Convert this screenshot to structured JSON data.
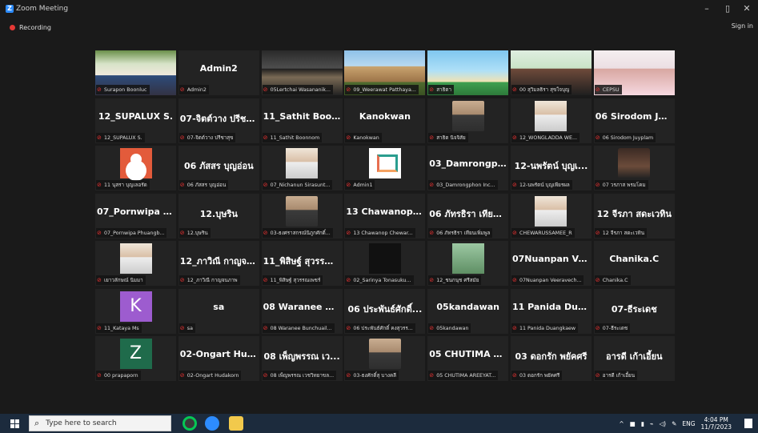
{
  "window": {
    "title": "Zoom Meeting",
    "minimize": "–",
    "restore": "▯",
    "close": "✕"
  },
  "recording": {
    "label": "Recording"
  },
  "signin": "Sign in",
  "tiles": [
    {
      "name": "",
      "label": "Surapon Boonluc",
      "video": "room",
      "active": true
    },
    {
      "name": "Admin2",
      "label": "Admin2"
    },
    {
      "name": "",
      "label": "05Lertchai Wasananik...",
      "video": "building"
    },
    {
      "name": "",
      "label": "09_Weerawat Patthaya...",
      "video": "palace"
    },
    {
      "name": "",
      "label": "สาธิตา",
      "video": "beach"
    },
    {
      "name": "",
      "label": "00 สุวิมลธิรา สุขใจบุญ",
      "video": "woman"
    },
    {
      "name": "",
      "label": "CEPSU",
      "video": "woman2"
    },
    {
      "name": "12_SUPALUX S.",
      "label": "12_SUPALUX S."
    },
    {
      "name": "07-จิตต์วาง ปรีชา...",
      "label": "07-จิตต์วาง ปรีชาสุข"
    },
    {
      "name": "11_Sathit Boon...",
      "label": "11_Sathit Boonnom"
    },
    {
      "name": "Kanokwan",
      "label": "Kanokwan"
    },
    {
      "name": "",
      "label": "สาธิต นิจจิสัย",
      "avatar": "person"
    },
    {
      "name": "",
      "label": "12_WONGLADDA WE...",
      "avatar": "light"
    },
    {
      "name": "06 Sirodom Juy...",
      "label": "06 Sirodom Juyplam"
    },
    {
      "name": "",
      "label": "11 นุสรา บุญเลอรัด",
      "avatar": "orange"
    },
    {
      "name": "06 ภัสสร บุญอ่อน",
      "label": "06 ภัสสร บุญอ่อน"
    },
    {
      "name": "",
      "label": "07_Nichanun Sirasunt...",
      "avatar": "light"
    },
    {
      "name": "",
      "label": "Admin1",
      "avatar": "logo"
    },
    {
      "name": "03_Damrongph...",
      "label": "03_Damrongphon Inc..."
    },
    {
      "name": "12-นพรัตน์ บุญเ...",
      "label": "12-นพรัตน์ บุญเพียรผล"
    },
    {
      "name": "",
      "label": "07 วรภาส พรมโคม",
      "avatar": "animated"
    },
    {
      "name": "07_Pornwipa Ph...",
      "label": "07_Pornwipa Phuangb..."
    },
    {
      "name": "12.บุษริน",
      "label": "12.บุษริน"
    },
    {
      "name": "",
      "label": "03-ธงศราสกรณ์นิภูกศักดิ์...",
      "avatar": "person"
    },
    {
      "name": "13 Chawanop C...",
      "label": "13 Chawanop Chewar..."
    },
    {
      "name": "06 ภัทรธิรา เทียน...",
      "label": "06 ภัทรธิรา เทียนเพิ่มพูล"
    },
    {
      "name": "",
      "label": "CHEWARUSSAMEE_R",
      "avatar": "light"
    },
    {
      "name": "12 จีรภา สดะเวทิน",
      "label": "12 จีรภา สดะเวทิน"
    },
    {
      "name": "",
      "label": "เยาวลักษณ์ นิมมา",
      "avatar": "light"
    },
    {
      "name": "12_ภาวิณี กาญจน...",
      "label": "12_ภาวิณี กาญจนภาพ"
    },
    {
      "name": "11_พิสิษฐ์ สุวรรณ...",
      "label": "11_พิสิษฐ์ สุวรรณเพชร์"
    },
    {
      "name": "",
      "label": "02_Sarinya Tonasuku...",
      "avatar": "dark"
    },
    {
      "name": "",
      "label": "12_ชนกนุช ศรีสมัย",
      "avatar": "green"
    },
    {
      "name": "07Nuanpan Vee...",
      "label": "07Nuanpan Veeravech..."
    },
    {
      "name": "Chanika.C",
      "label": "Chanika.C"
    },
    {
      "name": "",
      "label": "11_Kataya Ms",
      "avatar": "K"
    },
    {
      "name": "sa",
      "label": "sa"
    },
    {
      "name": "08 Waranee Bu...",
      "label": "08 Waranee Bunchuail..."
    },
    {
      "name": "06 ประพันธ์ศักดิ์...",
      "label": "06 ประพันธ์ศักดิ์ คงสุวรร..."
    },
    {
      "name": "05kandawan",
      "label": "05kandawan"
    },
    {
      "name": "11 Panida Duan...",
      "label": "11 Panida Duangkaew"
    },
    {
      "name": "07-ธีระเดช",
      "label": "07-ธีระเดช"
    },
    {
      "name": "",
      "label": "00 prapaporn",
      "avatar": "Z"
    },
    {
      "name": "02-Ongart Hud...",
      "label": "02-Ongart Hudakorn"
    },
    {
      "name": "08 เพ็ญพรรณ เว...",
      "label": "08 เพ็ญพรรณ เวชวิทยาขล..."
    },
    {
      "name": "",
      "label": "03-ธงศักดิ์สุ บางคลี",
      "avatar": "person"
    },
    {
      "name": "05 CHUTIMA A...",
      "label": "05 CHUTIMA AREEYAT..."
    },
    {
      "name": "03 ดอกรัก พยัคศรี",
      "label": "03 ดอกรัก พยัคศรี"
    },
    {
      "name": "อารดี เก้าเอี้ยน",
      "label": "อารดี เก้าเอี้ยน"
    }
  ],
  "avatar_letters": {
    "K": "K",
    "Z": "Z"
  },
  "taskbar": {
    "search_placeholder": "Type here to search",
    "tray_lang": "ENG",
    "time": "4:04 PM",
    "date": "11/7/2023"
  },
  "colors": {
    "active_border": "#7cd23a",
    "mic_off": "#e33333",
    "zoom_blue": "#2d8cff",
    "taskbar": "#1c2b3d"
  }
}
